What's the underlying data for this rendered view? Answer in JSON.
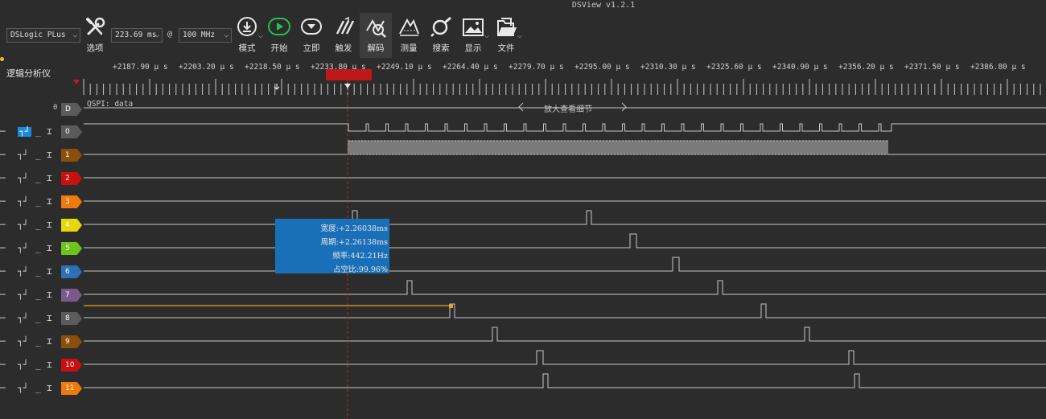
{
  "window": {
    "title": "DSView v1.2.1"
  },
  "toolbar": {
    "device": "DSLogic PLus",
    "duration": "223.69 ms",
    "at_symbol": "@",
    "samplerate": "100 MHz",
    "tools": [
      {
        "label": "选项",
        "icon": "wrench-screwdriver-icon"
      },
      {
        "label": "模式",
        "icon": "download-mode-icon"
      },
      {
        "label": "开始",
        "icon": "play-icon"
      },
      {
        "label": "立即",
        "icon": "instant-icon"
      },
      {
        "label": "触发",
        "icon": "trigger-icon"
      },
      {
        "label": "解码",
        "icon": "decode-icon"
      },
      {
        "label": "测量",
        "icon": "measure-icon"
      },
      {
        "label": "搜索",
        "icon": "search-icon"
      },
      {
        "label": "显示",
        "icon": "display-icon"
      },
      {
        "label": "文件",
        "icon": "file-icon"
      }
    ]
  },
  "ruler": {
    "panel_label": "逻辑分析仪",
    "ticks": [
      "+2187.90 μ s",
      "+2203.20 μ s",
      "+2218.50 μ s",
      "+2233.80 μ s",
      "+2249.10 μ s",
      "+2264.40 μ s",
      "+2279.70 μ s",
      "+2295.00 μ s",
      "+2310.30 μ s",
      "+2325.60 μ s",
      "+2340.90 μ s",
      "+2356.20 μ s",
      "+2371.50 μ s",
      "+2386.80 μ s"
    ]
  },
  "decode": {
    "index": "0",
    "tag": "D",
    "name": "QSPI: data",
    "hint": "放大查看细节"
  },
  "channels": [
    {
      "id": "0",
      "color": "#5b5b5b"
    },
    {
      "id": "1",
      "color": "#8a4f0c"
    },
    {
      "id": "2",
      "color": "#c81010"
    },
    {
      "id": "3",
      "color": "#ee7a0c"
    },
    {
      "id": "4",
      "color": "#e8d70a"
    },
    {
      "id": "5",
      "color": "#6cc41c"
    },
    {
      "id": "6",
      "color": "#2e6fb5"
    },
    {
      "id": "7",
      "color": "#7a5a8e"
    },
    {
      "id": "8",
      "color": "#5b5b5b"
    },
    {
      "id": "9",
      "color": "#8a4f0c"
    },
    {
      "id": "10",
      "color": "#c81010"
    },
    {
      "id": "11",
      "color": "#ee7a0c"
    }
  ],
  "measurement": {
    "width": "宽度:+2.26038ms",
    "period": "周期:+2.26138ms",
    "frequency": "频率:442.21Hz",
    "duty": "占空比:99.96%"
  },
  "colors": {
    "accent": "#1a70b8",
    "cursor": "#c01818",
    "background": "#2c2c2c",
    "measure_line": "#f0a020"
  }
}
